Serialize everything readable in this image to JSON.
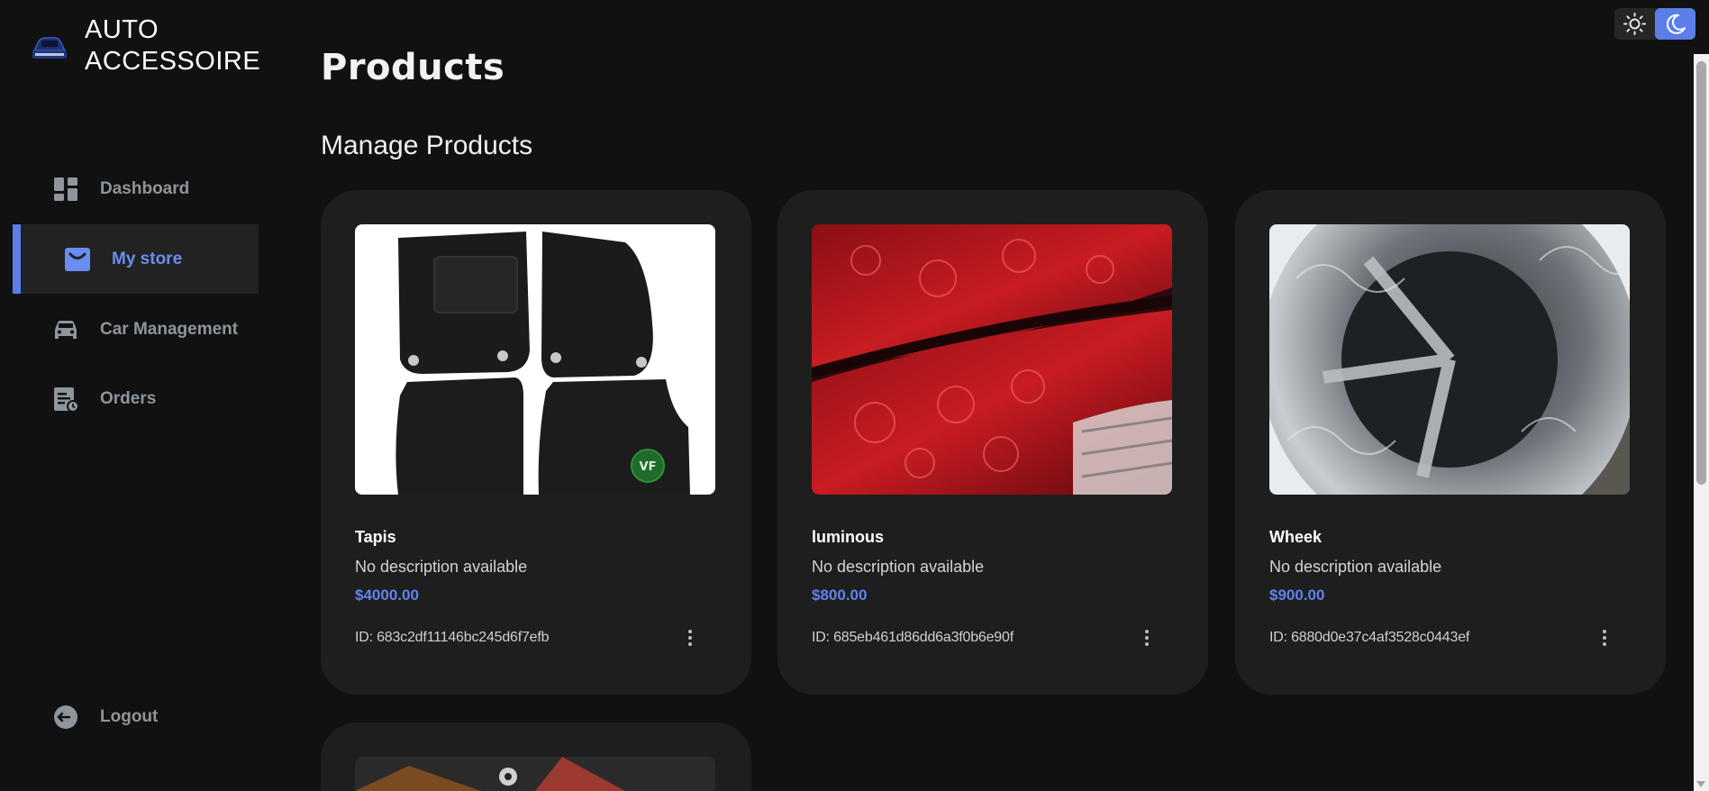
{
  "brand": {
    "line1": "AUTO",
    "line2": "ACCESSOIRE",
    "logo_icon": "car-logo-icon"
  },
  "sidebar": {
    "items": [
      {
        "label": "Dashboard",
        "icon": "dashboard-icon",
        "active": false
      },
      {
        "label": "My store",
        "icon": "store-icon",
        "active": true
      },
      {
        "label": "Car Management",
        "icon": "car-icon",
        "active": false
      },
      {
        "label": "Orders",
        "icon": "orders-icon",
        "active": false
      }
    ],
    "logout": {
      "label": "Logout",
      "icon": "logout-icon"
    }
  },
  "page": {
    "title": "Products",
    "section_title": "Manage Products"
  },
  "products": [
    {
      "name": "Tapis",
      "description": "No description available",
      "price": "$4000.00",
      "id_text": "ID: 683c2df11146bc245d6f7efb",
      "image": "car-floor-mats"
    },
    {
      "name": "luminous",
      "description": "No description available",
      "price": "$800.00",
      "id_text": "ID: 685eb461d86dd6a3f0b6e90f",
      "image": "engraved-red-tail-lights"
    },
    {
      "name": "Wheek",
      "description": "No description available",
      "price": "$900.00",
      "id_text": "ID: 6880d0e37c4af3528c0443ef",
      "image": "engraved-chrome-wheel"
    }
  ],
  "theme": {
    "light_icon": "sun-icon",
    "dark_icon": "moon-icon",
    "selected": "dark"
  },
  "colors": {
    "accent": "#5b7ee8",
    "price": "#5f82ee",
    "background": "#111111",
    "card": "#1e1e1e"
  }
}
